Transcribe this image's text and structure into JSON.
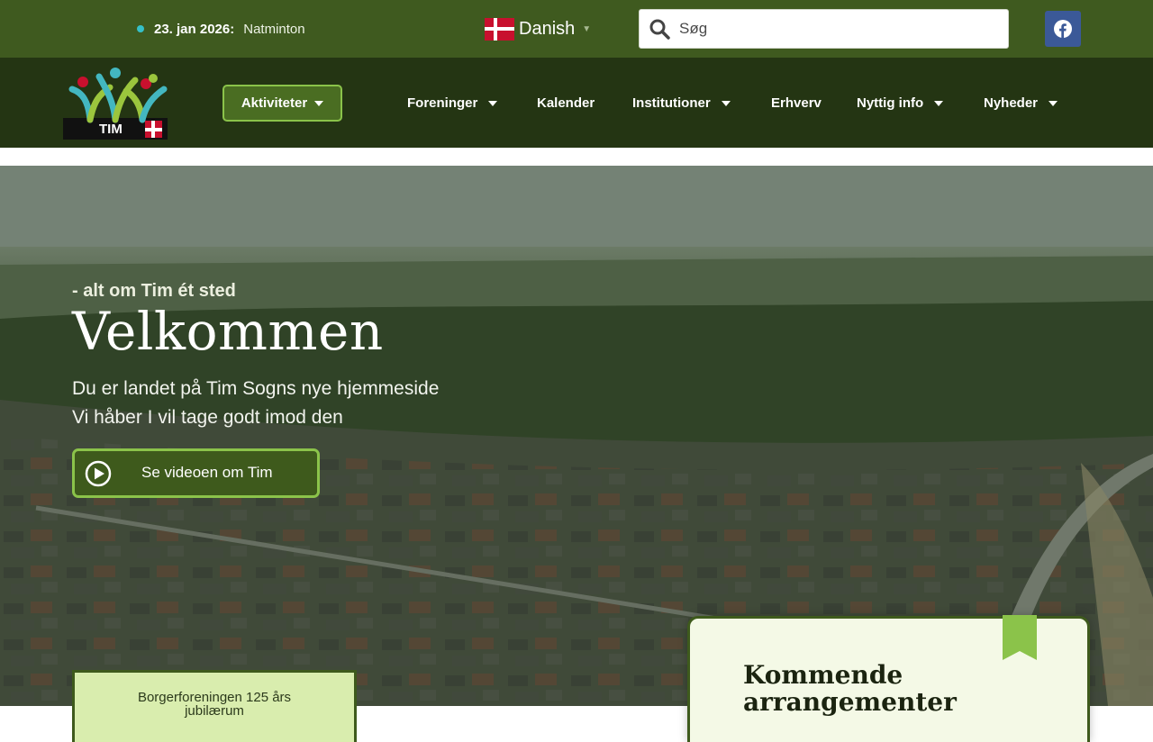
{
  "topbar": {
    "ticker_date": "23. jan 2026:",
    "ticker_text": "Natminton",
    "language": "Danish",
    "search_placeholder": "Søg"
  },
  "nav": {
    "logo_text": "TIM",
    "activities_button": "Aktiviteter",
    "items": [
      {
        "label": "Foreninger",
        "dropdown": true
      },
      {
        "label": "Kalender",
        "dropdown": false
      },
      {
        "label": "Institutioner",
        "dropdown": true
      },
      {
        "label": "Erhverv",
        "dropdown": false
      },
      {
        "label": "Nyttig info",
        "dropdown": true
      },
      {
        "label": "Nyheder",
        "dropdown": true
      }
    ]
  },
  "hero": {
    "tagline": "- alt om Tim ét sted",
    "title": "Velkommen",
    "subtitle_line1": "Du er landet på Tim Sogns nye hjemmeside",
    "subtitle_line2": "Vi håber I vil tage godt imod den",
    "video_button": "Se videoen om Tim"
  },
  "cards": {
    "jubilee_line1": "Borgerforeningen 125 års",
    "jubilee_line2": "jubilærum",
    "events_line1": "Kommende",
    "events_line2": "arrangementer"
  },
  "colors": {
    "topbar": "#3f5a1f",
    "navbar": "#243513",
    "accent": "#8bc34a",
    "facebook": "#3b5998"
  },
  "icons": [
    "dot-icon",
    "danish-flag-icon",
    "search-icon",
    "facebook-icon",
    "chevron-down-icon",
    "play-icon",
    "bookmark-icon"
  ]
}
